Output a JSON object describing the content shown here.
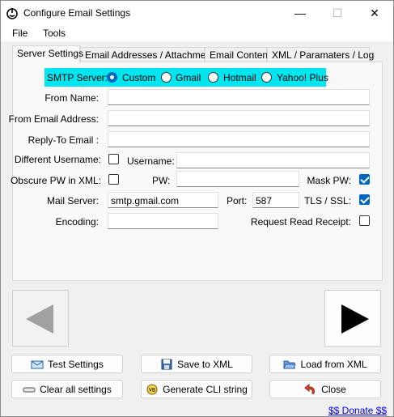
{
  "window": {
    "title": "Configure Email Settings",
    "controls": {
      "minimize": "—",
      "maximize": "☐",
      "close": "✕"
    }
  },
  "menu": [
    "File",
    "Tools"
  ],
  "tabs": [
    "Server Settings",
    "Email Addresses / Attachment",
    "Email Content",
    "XML / Paramaters / Log"
  ],
  "smtp": {
    "label": "SMTP Server:",
    "options": [
      "Custom",
      "Gmail",
      "Hotmail",
      "Yahoo! Plus"
    ],
    "selected": "Custom"
  },
  "form": {
    "from_name_label": "From Name:",
    "from_name_value": "",
    "from_email_label": "From Email Address:",
    "from_email_value": "",
    "reply_to_label": "Reply-To Email :",
    "reply_to_value": "",
    "different_username_label": "Different Username:",
    "different_username_checked": false,
    "username_label": "Username:",
    "username_value": "",
    "obscure_pw_label": "Obscure PW in XML:",
    "obscure_pw_checked": false,
    "pw_label": "PW:",
    "pw_value": "",
    "mask_pw_label": "Mask PW:",
    "mask_pw_checked": true,
    "mail_server_label": "Mail Server:",
    "mail_server_value": "smtp.gmail.com",
    "port_label": "Port:",
    "port_value": "587",
    "tls_label": "TLS / SSL:",
    "tls_checked": true,
    "encoding_label": "Encoding:",
    "encoding_value": "",
    "read_receipt_label": "Request Read Receipt:",
    "read_receipt_checked": false
  },
  "buttons": {
    "test": "Test Settings",
    "save_xml": "Save to XML",
    "load_xml": "Load from XML",
    "clear": "Clear all settings",
    "cli": "Generate CLI string",
    "close": "Close"
  },
  "donate": "$$ Donate $$",
  "colors": {
    "smtp_highlight": "#00e5ef",
    "accent": "#0067c0",
    "link": "#0000ee"
  }
}
